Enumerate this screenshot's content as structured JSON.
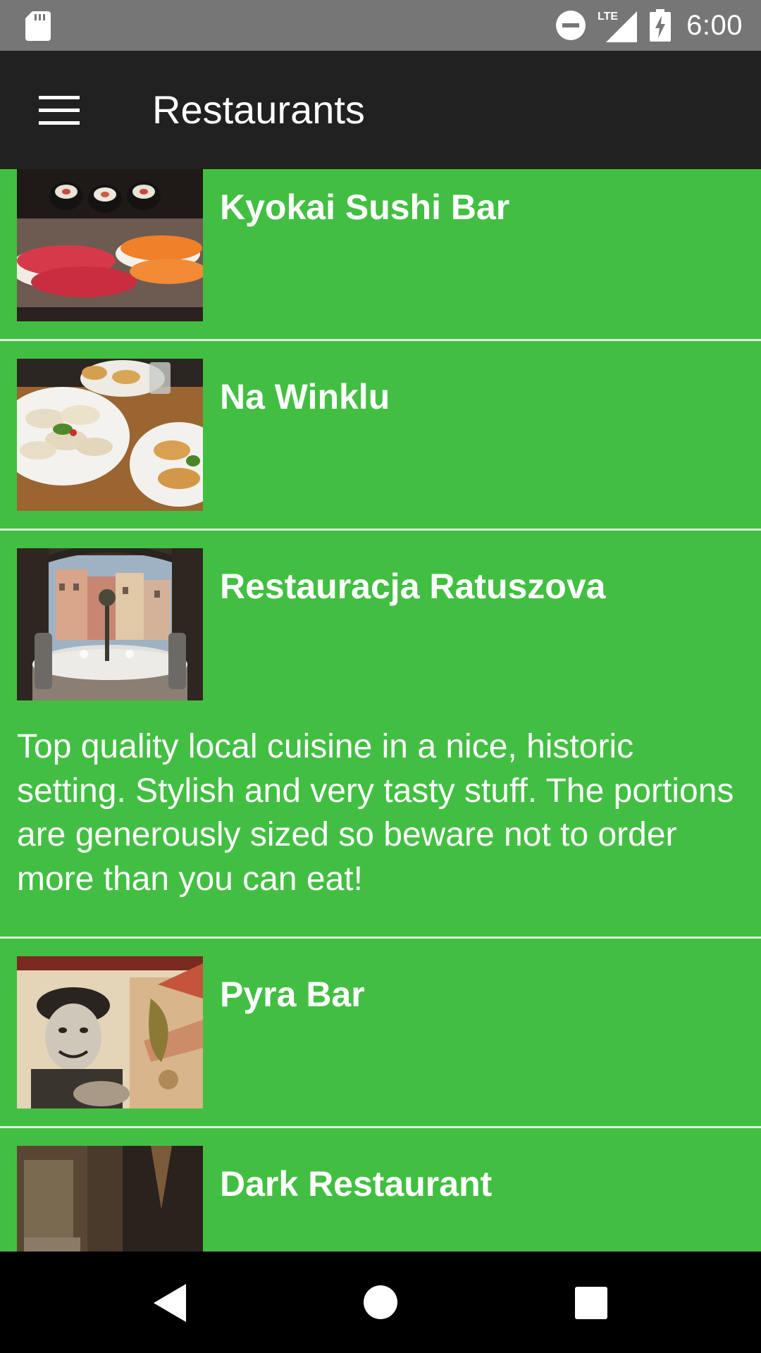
{
  "status_bar": {
    "time": "6:00",
    "network": "LTE",
    "icons": [
      "sd-card-icon",
      "do-not-disturb-icon",
      "lte-signal-icon",
      "battery-charging-icon"
    ]
  },
  "toolbar": {
    "title": "Restaurants",
    "menu_icon": "hamburger-menu-icon"
  },
  "colors": {
    "list_background": "#42bf42",
    "toolbar_background": "#212121",
    "status_bar_background": "#767676",
    "divider": "#e3f5e3",
    "text": "#ffffff"
  },
  "restaurants": [
    {
      "name": "Kyokai Sushi Bar",
      "image": "sushi-photo",
      "description": ""
    },
    {
      "name": "Na Winklu",
      "image": "dumplings-photo",
      "description": ""
    },
    {
      "name": "Restauracja Ratuszova",
      "image": "dining-room-photo",
      "description": "Top quality local cuisine in a nice, historic setting. Stylish and very tasty stuff. The portions are generously sized so beware not to order more than you can eat!"
    },
    {
      "name": "Pyra Bar",
      "image": "socialist-poster-photo",
      "description": ""
    },
    {
      "name": "Dark Restaurant",
      "image": "dark-entrance-photo",
      "description": ""
    }
  ],
  "nav_bar": {
    "buttons": [
      "back-icon",
      "home-icon",
      "recents-icon"
    ]
  }
}
